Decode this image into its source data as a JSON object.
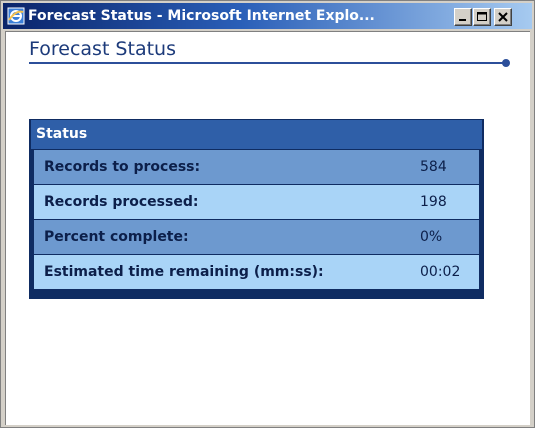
{
  "window": {
    "title": "Forecast Status - Microsoft Internet Explo...",
    "icon": "ie-icon",
    "controls": [
      "minimize-icon",
      "maximize-icon",
      "close-icon"
    ]
  },
  "page": {
    "title": "Forecast Status"
  },
  "status_panel": {
    "header": "Status",
    "rows": [
      {
        "label": "Records to process:",
        "value": "584"
      },
      {
        "label": "Records processed:",
        "value": "198"
      },
      {
        "label": "Percent complete:",
        "value": "0%"
      },
      {
        "label": "Estimated time remaining (mm:ss):",
        "value": "00:02"
      }
    ]
  },
  "colors": {
    "titlebar": "#0a246a",
    "heading": "#1c3a7a",
    "panel_border": "#0f2c62",
    "panel_header": "#2f5fa8",
    "row_dark": "#6d99cf",
    "row_light": "#a9d4f7"
  }
}
